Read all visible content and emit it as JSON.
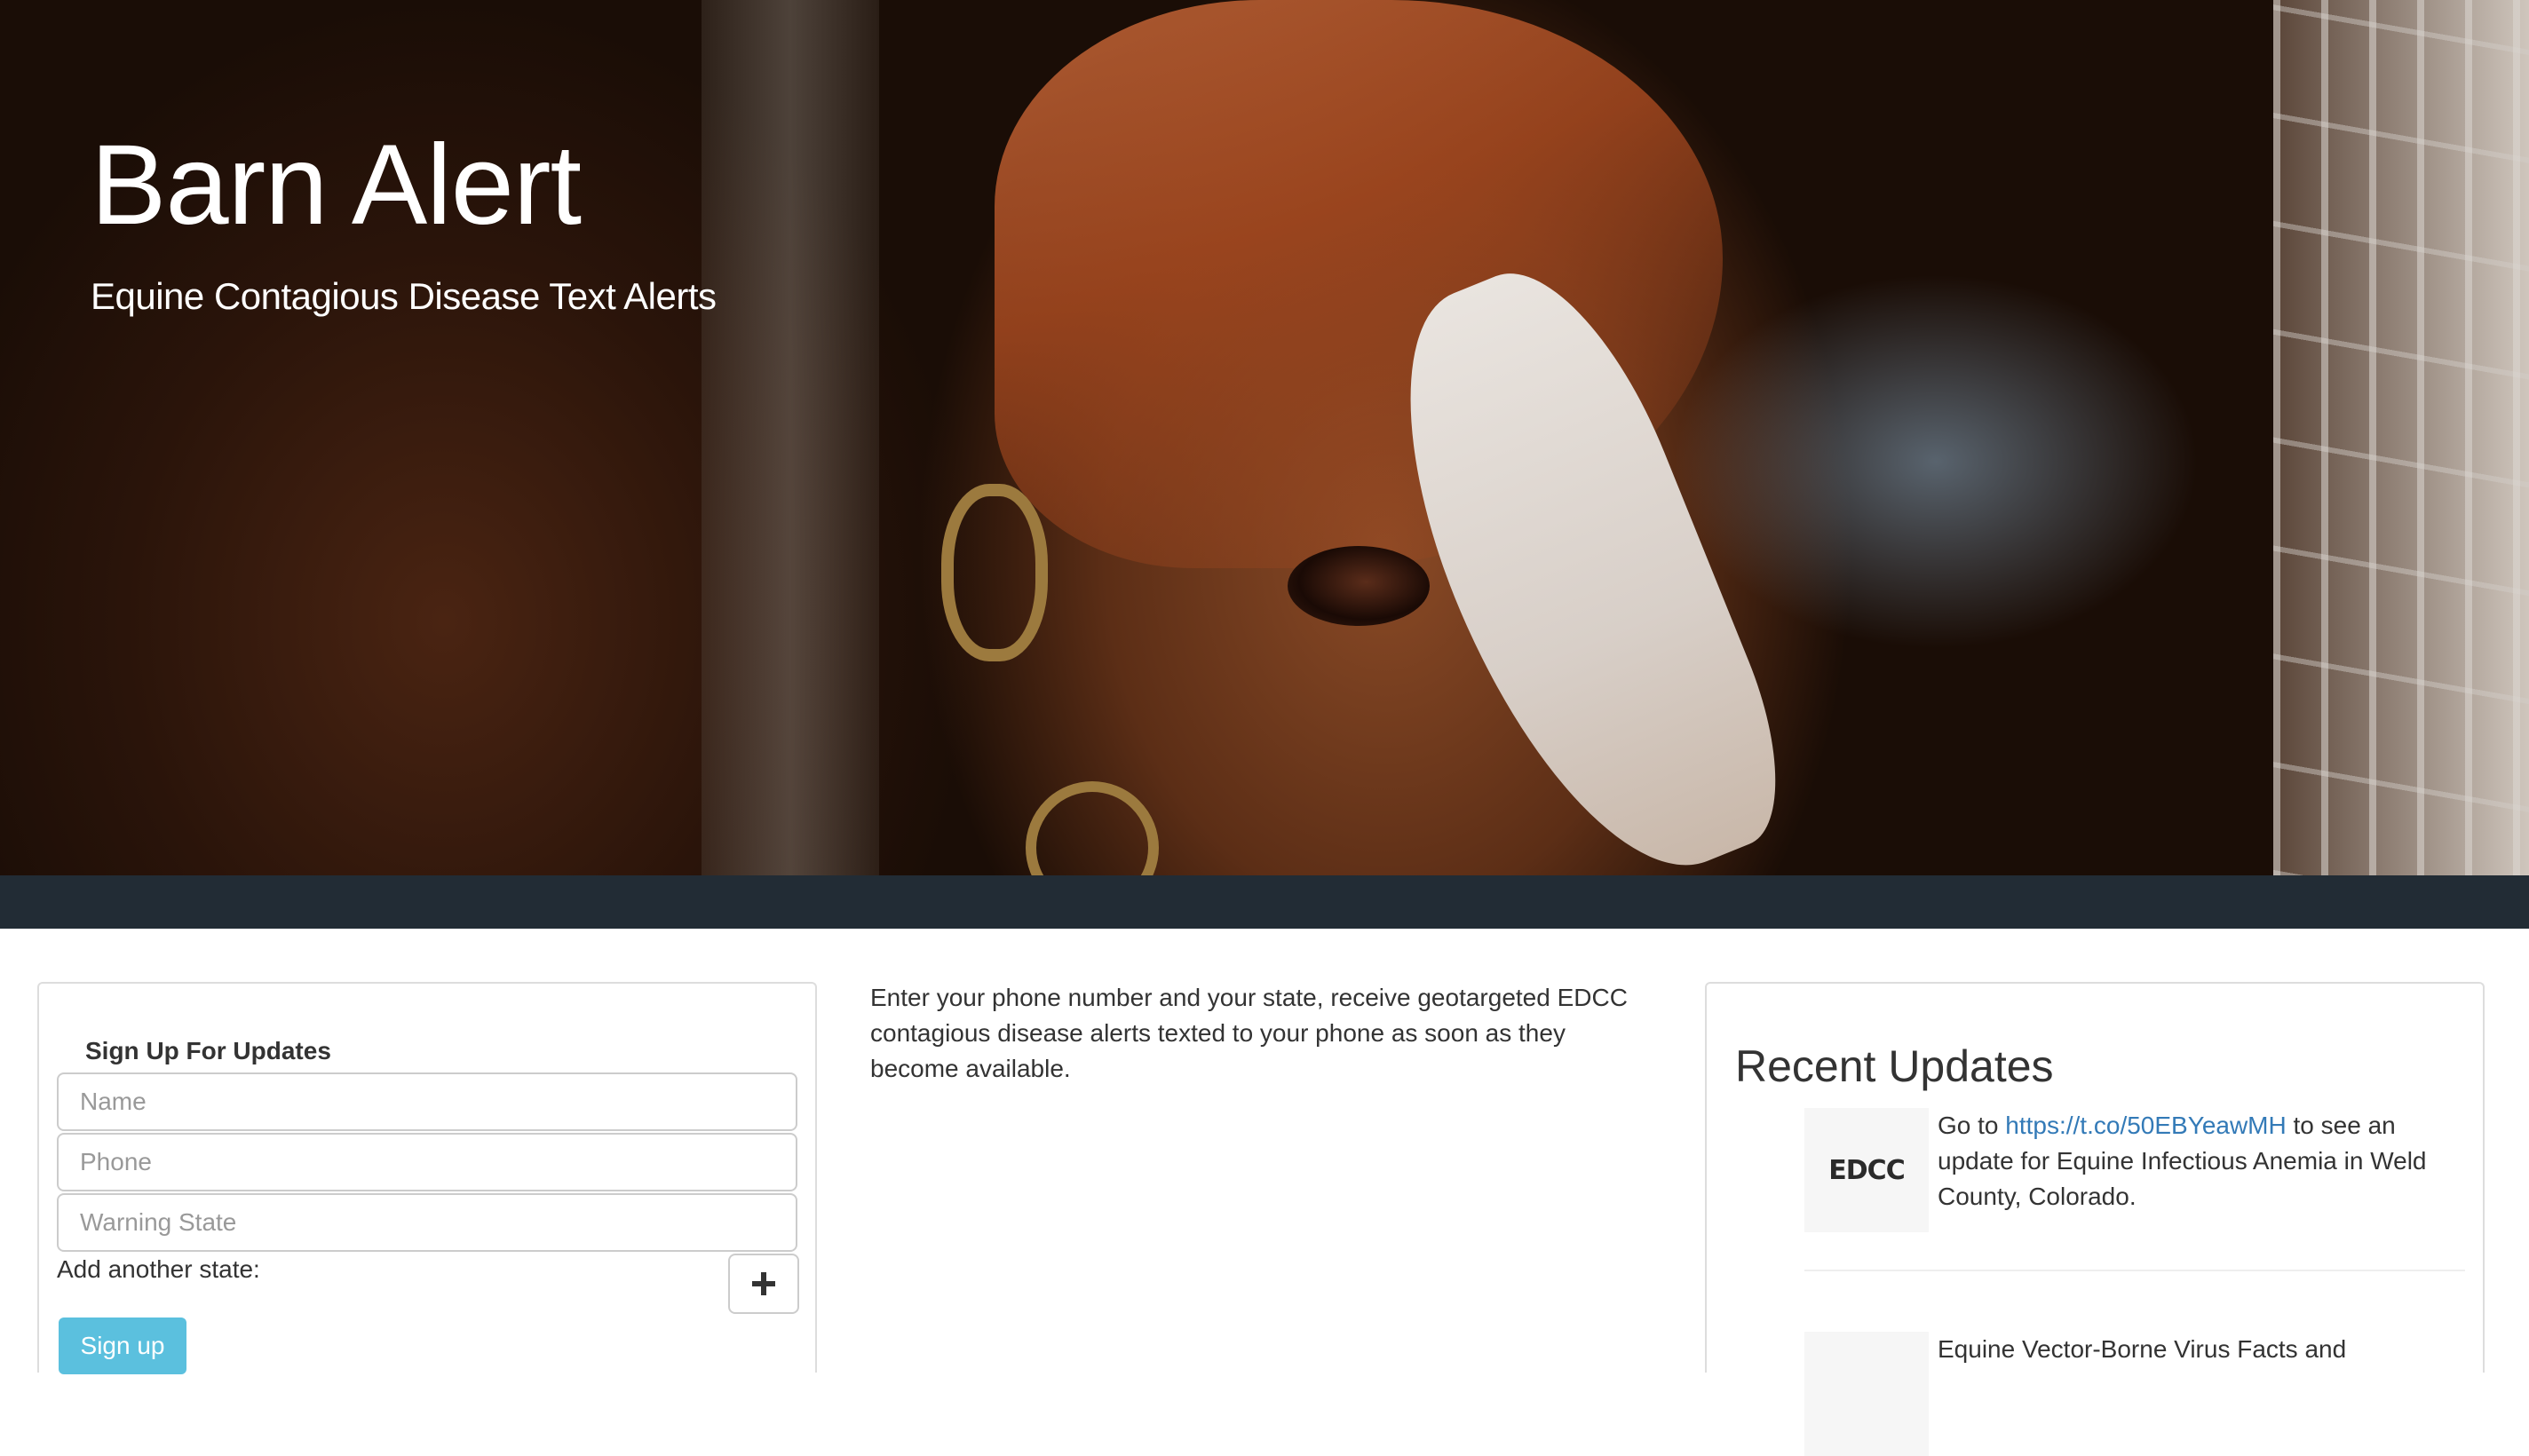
{
  "hero": {
    "title": "Barn Alert",
    "subtitle": "Equine Contagious Disease Text Alerts"
  },
  "signup": {
    "heading": "Sign Up For Updates",
    "name_placeholder": "Name",
    "phone_placeholder": "Phone",
    "state_placeholder": "Warning State",
    "add_state_label": "Add another state:",
    "add_state_icon": "plus-icon",
    "submit_label": "Sign up"
  },
  "intro": {
    "text": "Enter your phone number and your state, receive geotargeted EDCC contagious disease alerts texted to your phone as soon as they become available."
  },
  "updates": {
    "title": "Recent Updates",
    "items": [
      {
        "thumb_label": "EDCC",
        "text_before": "Go to ",
        "link": "https://t.co/50EBYeawMH",
        "text_after": " to see an update for Equine Infectious Anemia in Weld County, Colorado."
      },
      {
        "thumb_label": "",
        "text_before": "Equine Vector-Borne Virus Facts and",
        "link": "",
        "text_after": ""
      }
    ]
  },
  "colors": {
    "navbar": "#222c35",
    "signup_button": "#5bc0de",
    "link": "#337ab7"
  }
}
